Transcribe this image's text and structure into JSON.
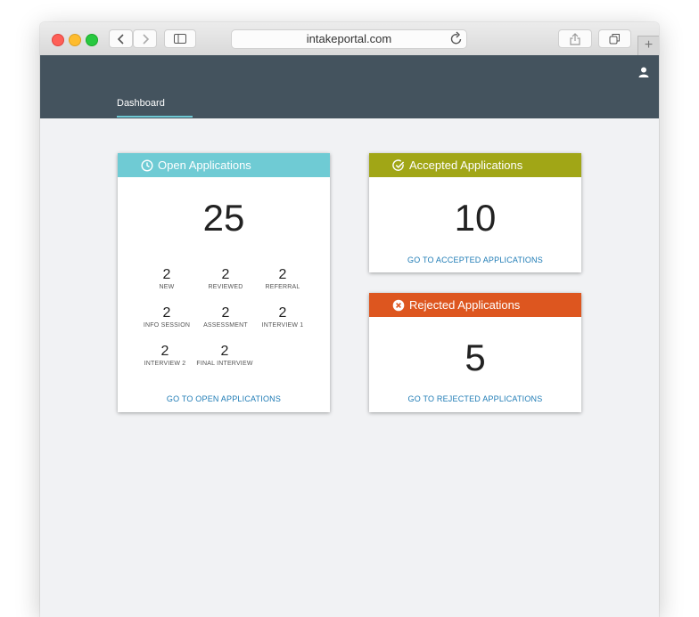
{
  "browser": {
    "url": "intakeportal.com",
    "new_tab_glyph": "+"
  },
  "app": {
    "nav_tab": "Dashboard"
  },
  "cards": {
    "open": {
      "title": "Open Applications",
      "count": "25",
      "color": "#6fcbd4",
      "stats": [
        {
          "value": "2",
          "label": "NEW"
        },
        {
          "value": "2",
          "label": "REVIEWED"
        },
        {
          "value": "2",
          "label": "REFERRAL"
        },
        {
          "value": "2",
          "label": "INFO SESSION"
        },
        {
          "value": "2",
          "label": "ASSESSMENT"
        },
        {
          "value": "2",
          "label": "INTERVIEW 1"
        },
        {
          "value": "2",
          "label": "INTERVIEW 2"
        },
        {
          "value": "2",
          "label": "FINAL INTERVIEW"
        }
      ],
      "link": "GO TO OPEN APPLICATIONS"
    },
    "accepted": {
      "title": "Accepted Applications",
      "count": "10",
      "color": "#a1a616",
      "link": "GO TO ACCEPTED APPLICATIONS"
    },
    "rejected": {
      "title": "Rejected Applications",
      "count": "5",
      "color": "#dd561f",
      "link": "GO TO REJECTED APPLICATIONS"
    }
  }
}
